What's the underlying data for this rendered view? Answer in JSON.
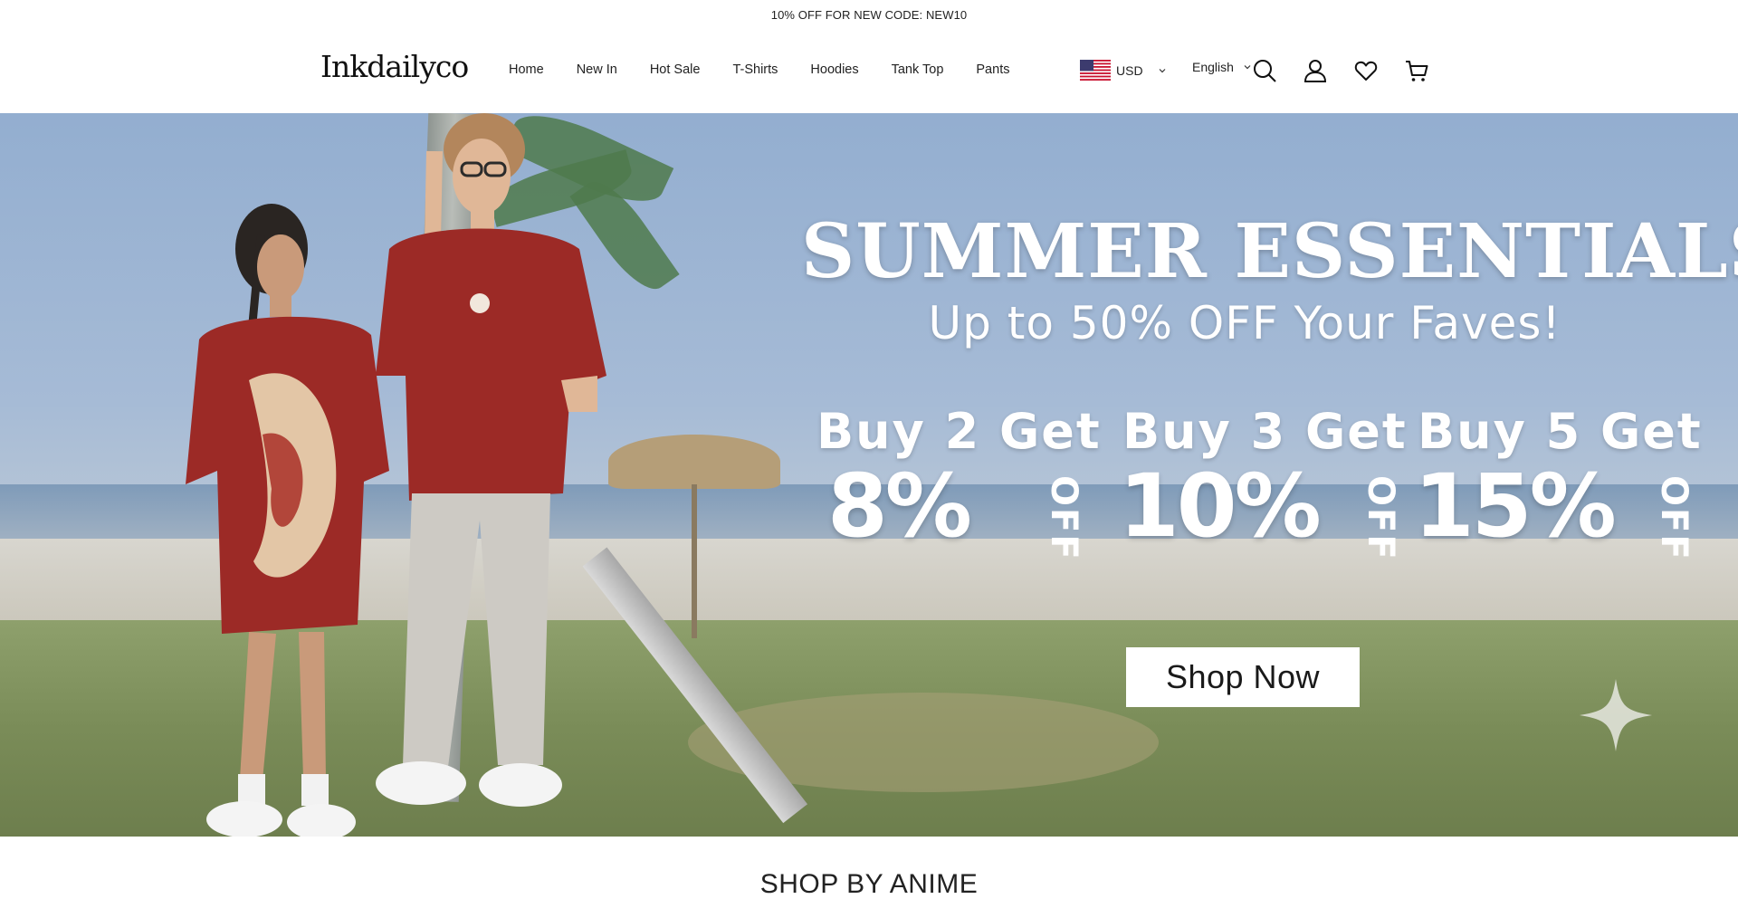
{
  "announcement": {
    "text": "10% OFF FOR NEW CODE: NEW10"
  },
  "header": {
    "logo": "Inkdailyco",
    "nav": [
      {
        "label": "Home"
      },
      {
        "label": "New In"
      },
      {
        "label": "Hot Sale"
      },
      {
        "label": "T-Shirts"
      },
      {
        "label": "Hoodies"
      },
      {
        "label": "Tank Top"
      },
      {
        "label": "Pants"
      }
    ],
    "currency": {
      "label": "USD",
      "flag_icon": "us-flag-icon"
    },
    "language": {
      "label": "English"
    },
    "icons": [
      "search-icon",
      "account-icon",
      "wishlist-heart-icon",
      "cart-icon"
    ]
  },
  "hero": {
    "headline": "SUMMER ESSENTIALS",
    "subheadline": "Up to 50% OFF Your Faves!",
    "offers": [
      {
        "condition": "Buy 2 Get",
        "discount": "8%",
        "suffix": "OFF"
      },
      {
        "condition": "Buy 3 Get",
        "discount": "10%",
        "suffix": "OFF"
      },
      {
        "condition": "Buy 5 Get",
        "discount": "15%",
        "suffix": "OFF"
      }
    ],
    "cta": "Shop Now"
  },
  "sections": {
    "shop_by_anime": "SHOP BY ANIME"
  },
  "colors": {
    "text": "#1a1a1a",
    "hero_sky": "#93aed0",
    "shirt_red": "#9c2a26",
    "white": "#ffffff"
  }
}
